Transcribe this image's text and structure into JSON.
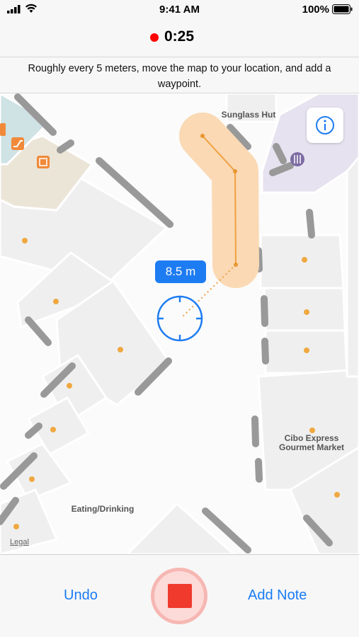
{
  "status_bar": {
    "time": "9:41 AM",
    "battery": "100%"
  },
  "recording": {
    "elapsed": "0:25",
    "dot_color": "#ff0000"
  },
  "instruction": "Roughly every 5 meters, move the map to your location, and add a waypoint.",
  "map": {
    "labels": {
      "sunglass": "Sunglass Hut",
      "cibo_line1": "Cibo Express",
      "cibo_line2": "Gourmet Market",
      "eating": "Eating/Drinking",
      "legal": "Legal"
    },
    "distance": "8.5 m",
    "info_icon": "info-icon",
    "accent_color": "#1e7cf2",
    "path_color": "#f0a040"
  },
  "bottom": {
    "undo_label": "Undo",
    "add_note_label": "Add Note",
    "record_icon": "stop-icon",
    "record_color": "#f03a2e"
  }
}
